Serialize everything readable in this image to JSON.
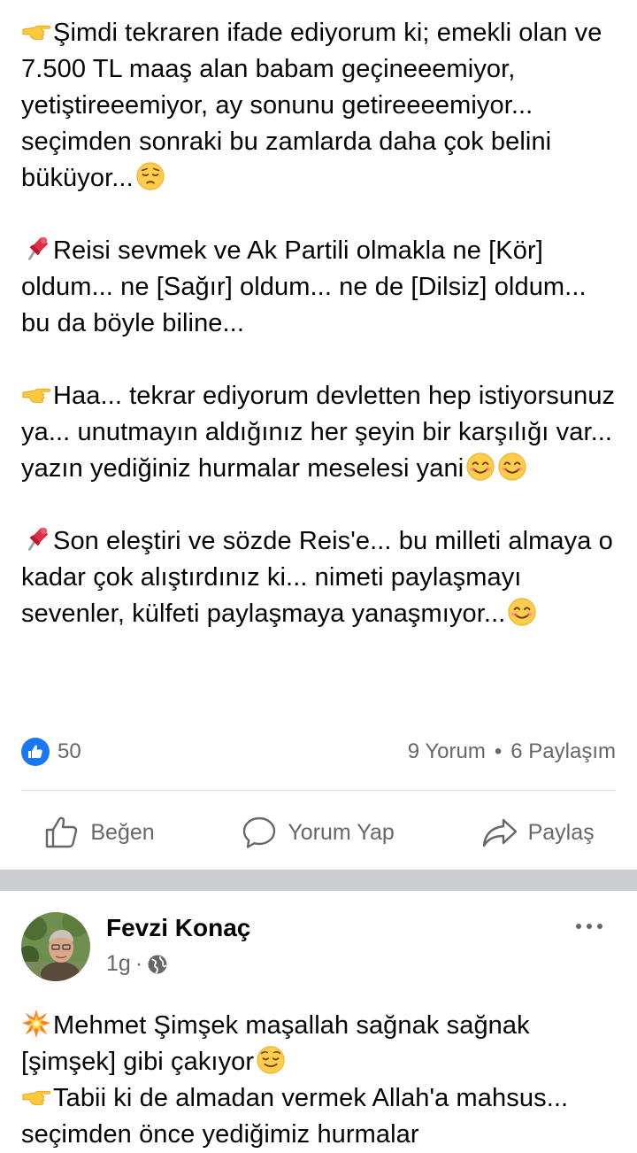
{
  "post1": {
    "paragraphs": [
      {
        "emoji": "pointing-right-icon",
        "text": "Şimdi tekraren ifade ediyorum ki; emekli olan ve 7.500 TL maaş alan babam geçineeemiyor, yetiştireeemiyor, ay sonunu getireeeemiyor... seçimden sonraki bu zamlarda daha çok belini büküyor...",
        "trail": "pensive-face-icon"
      },
      {
        "emoji": "pushpin-icon",
        "text": "Reisi sevmek ve Ak Partili olmakla ne [Kör] oldum... ne [Sağır] oldum... ne de [Dilsiz] oldum... bu da böyle biline...",
        "trail": ""
      },
      {
        "emoji": "pointing-right-icon",
        "text": "Haa... tekrar ediyorum devletten hep istiyorsunuz ya... unutmayın aldığınız her şeyin bir karşılığı var... yazın yediğiniz hurmalar meselesi yani",
        "trail": "smiling-face-icon"
      },
      {
        "emoji": "pushpin-icon",
        "text": "Son eleştiri ve sözde Reis'e... bu milleti almaya o kadar çok alıştırdınız ki... nimeti paylaşmayı sevenler, külfeti paylaşmaya yanaşmıyor...",
        "trail": "smiling-face-icon"
      }
    ],
    "reaction_count": "50",
    "comments": "9 Yorum",
    "separator": "•",
    "shares": "6 Paylaşım",
    "actions": {
      "like": "Beğen",
      "comment": "Yorum Yap",
      "share": "Paylaş"
    }
  },
  "post2": {
    "author": "Fevzi Konaç",
    "time": "1g",
    "time_separator": "·",
    "lines": [
      {
        "emoji": "collision-icon",
        "text": "Mehmet Şimşek maşallah sağnak sağnak [şimşek] gibi çakıyor",
        "trail": "relieved-face-icon"
      },
      {
        "emoji": "pointing-right-icon",
        "text": "Tabii ki de almadan vermek Allah'a mahsus... seçimden önce yediğimiz hurmalar",
        "trail": ""
      }
    ]
  },
  "colors": {
    "text": "#050505",
    "muted": "#65676b",
    "brand_blue": "#1877f2",
    "divider": "#dadde1",
    "separator_bar": "#cbcdd1"
  }
}
